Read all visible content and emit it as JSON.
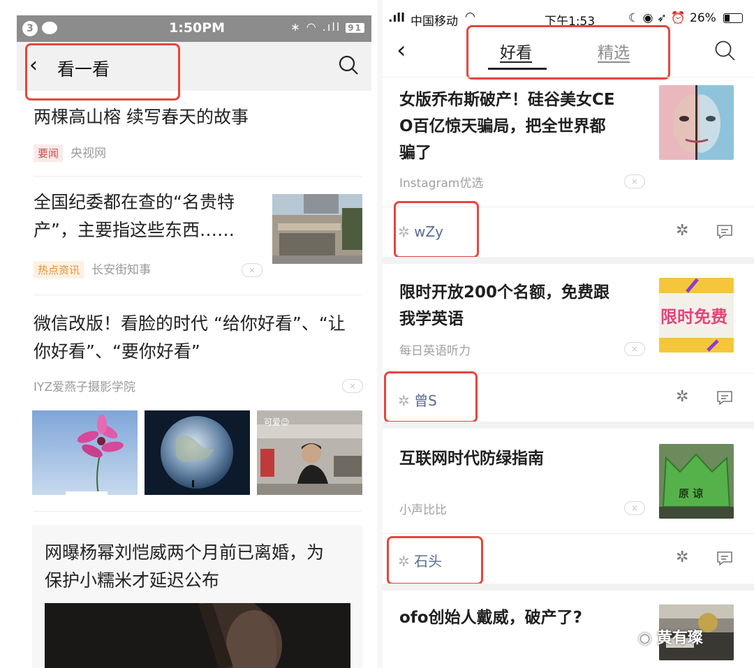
{
  "left": {
    "status": {
      "badge": "3",
      "time": "1:50PM",
      "battery": "91"
    },
    "nav": {
      "title": "看一看"
    },
    "articles": [
      {
        "title": "两棵高山榕 续写春天的故事",
        "tag": "要闻",
        "source": "央视网"
      },
      {
        "title_line1": "全国纪委都在查的“名贵特",
        "title_line2": "产”，主要指这些东西……",
        "tag": "热点资讯",
        "source": "长安街知事"
      },
      {
        "title_line1": "微信改版！看脸的时代 “给你好看”、“让",
        "title_line2": "你好看”、“要你好看”",
        "source": "IYZ爱燕子摄影学院",
        "image_caption": "可爱😉"
      },
      {
        "title_line1": "网曝杨幂刘恺威两个月前已离婚，为",
        "title_line2": "保护小糯米才延迟公布"
      }
    ]
  },
  "right": {
    "status": {
      "carrier": "中国移动",
      "time": "下午1:53",
      "battery": "26%"
    },
    "nav": {
      "tab_active": "好看",
      "tab_inactive": "精选"
    },
    "articles": [
      {
        "title_line1": "女版乔布斯破产！硅谷美女CE",
        "title_line2": "O百亿惊天骗局，把全世界都",
        "title_line3": "骗了",
        "source": "Instagram优选",
        "user": "wZy"
      },
      {
        "title_line1": "限时开放200个名额，免费跟",
        "title_line2": "我学英语",
        "source": "每日英语听力",
        "user": "曾S",
        "thumb_text": "限时免费"
      },
      {
        "title_line1": "互联网时代防绿指南",
        "source": "小声比比",
        "user": "石头",
        "thumb_text": "原 谅"
      },
      {
        "title_line1": "ofo创始人戴威，破产了?"
      }
    ],
    "watermark": "黄有璨"
  },
  "colors": {
    "highlight_box": "#e8453c",
    "link_user": "#576b95"
  }
}
